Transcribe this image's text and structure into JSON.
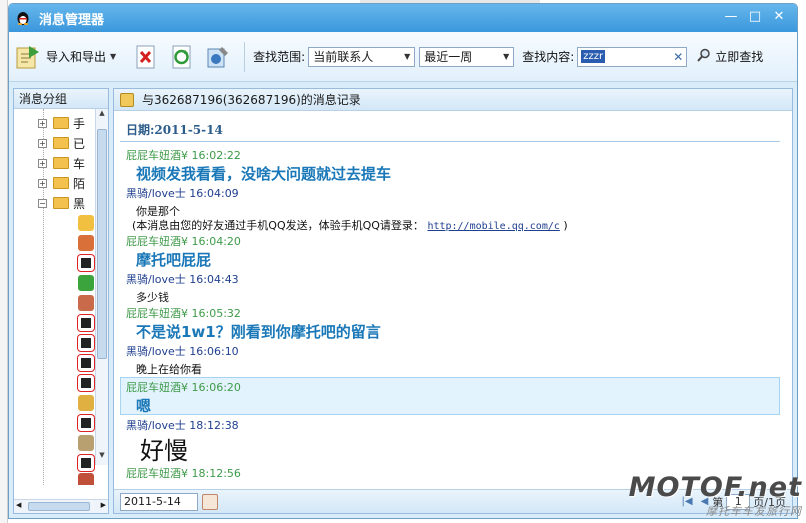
{
  "window": {
    "title": "消息管理器",
    "minimize_glyph": "—",
    "maximize_glyph": "□",
    "close_glyph": "✕"
  },
  "toolbar": {
    "import_export_label": "导入和导出",
    "scope_label": "查找范围:",
    "scope_value": "当前联系人",
    "period_value": "最近一周",
    "content_label": "查找内容:",
    "search_value": "zzzr",
    "find_label": "立即查找"
  },
  "sidebar": {
    "title": "消息分组",
    "groups": [
      {
        "label": "手"
      },
      {
        "label": "已"
      },
      {
        "label": "车"
      },
      {
        "label": "陌"
      },
      {
        "label": "黑"
      }
    ]
  },
  "header": {
    "record_title": "与362687196(362687196)的消息记录"
  },
  "messages": {
    "date_label": "日期:2011-5-14",
    "items": [
      {
        "sender": "屁屁车妞酒¥",
        "time": "16:02:22",
        "text": "视频发我看看，没啥大问题就过去提车"
      },
      {
        "sender": "黑骑/love士",
        "time": "16:04:09",
        "text": "你是那个",
        "note": "(本消息由您的好友通过手机QQ发送，体验手机QQ请登录：",
        "link": "http://mobile.qq.com/c",
        "note_end": ")"
      },
      {
        "sender": "屁屁车妞酒¥",
        "time": "16:04:20",
        "text": "摩托吧屁屁"
      },
      {
        "sender": "黑骑/love士",
        "time": "16:04:43",
        "text": "多少钱"
      },
      {
        "sender": "屁屁车妞酒¥",
        "time": "16:05:32",
        "text": "不是说1w1？刚看到你摩托吧的留言"
      },
      {
        "sender": "黑骑/love士",
        "time": "16:06:10",
        "text": "晚上在给你看"
      },
      {
        "sender": "屁屁车妞酒¥",
        "time": "16:06:20",
        "text": "嗯"
      },
      {
        "sender": "黑骑/love士",
        "time": "18:12:38",
        "text": "好慢"
      },
      {
        "sender": "屁屁车妞酒¥",
        "time": "18:12:56",
        "text": ""
      }
    ]
  },
  "footer": {
    "date_value": "2011-5-14",
    "page_prefix": "第",
    "page_value": "1",
    "page_suffix": "页/1页"
  },
  "watermark": {
    "main": "MOTOF.net",
    "sub": "摩托车车友旅行网"
  },
  "colors": {
    "title_bar": "#3b97dc",
    "sender_green": "#3d9a48",
    "sender_blue": "#1f3f8f",
    "message_blue": "#1a78b8"
  }
}
